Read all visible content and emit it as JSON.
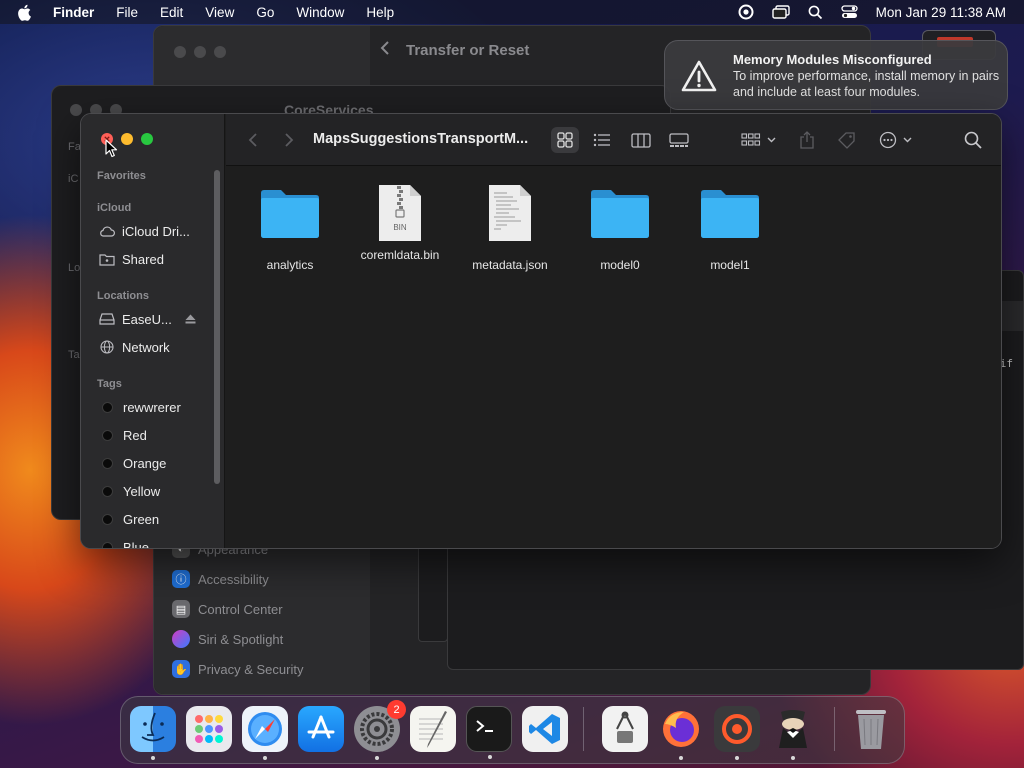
{
  "menubar": {
    "app_name": "Finder",
    "menus": [
      "File",
      "Edit",
      "View",
      "Go",
      "Window",
      "Help"
    ],
    "clock": "Mon Jan 29  11:38 AM"
  },
  "background": {
    "settings_header": "Transfer or Reset",
    "settings_items": [
      "Appearance",
      "Accessibility",
      "Control Center",
      "Siri & Spotlight",
      "Privacy & Security"
    ],
    "coreservices_title": "CoreServices",
    "coreservices_labels": [
      "Fa",
      "iC",
      "Lo",
      "Ta"
    ],
    "code_snippet": "if"
  },
  "notification": {
    "title": "Memory Modules Misconfigured",
    "body": "To improve performance, install memory in pairs and include at least four modules.",
    "icon": "warning-icon"
  },
  "finder": {
    "title": "MapsSuggestionsTransportM...",
    "sidebar": {
      "favorites_heading": "Favorites",
      "icloud_heading": "iCloud",
      "icloud_items": [
        {
          "label": "iCloud Dri...",
          "icon": "cloud-icon"
        },
        {
          "label": "Shared",
          "icon": "shared-folder-icon"
        }
      ],
      "locations_heading": "Locations",
      "location_items": [
        {
          "label": "EaseU...",
          "icon": "drive-icon"
        },
        {
          "label": "Network",
          "icon": "globe-icon"
        }
      ],
      "tags_heading": "Tags",
      "tags": [
        "rewwrerer",
        "Red",
        "Orange",
        "Yellow",
        "Green",
        "Blue"
      ]
    },
    "files": [
      {
        "name": "analytics",
        "kind": "folder"
      },
      {
        "name": "coremldata.bin",
        "kind": "bin",
        "badge": "BIN"
      },
      {
        "name": "metadata.json",
        "kind": "json"
      },
      {
        "name": "model0",
        "kind": "folder"
      },
      {
        "name": "model1",
        "kind": "folder"
      }
    ]
  },
  "dock": {
    "apps": [
      "Finder",
      "Launchpad",
      "Safari",
      "App Store",
      "System Settings",
      "TextEdit",
      "Terminal",
      "Visual Studio Code",
      "Archive Utility",
      "Firefox",
      "Synology Drive",
      "Bartender",
      "Trash"
    ],
    "settings_badge": "2"
  },
  "colors": {
    "accent_folder": "#38b6f5",
    "close": "#ff5f57",
    "minimize": "#febc2e",
    "zoom": "#28c840"
  }
}
